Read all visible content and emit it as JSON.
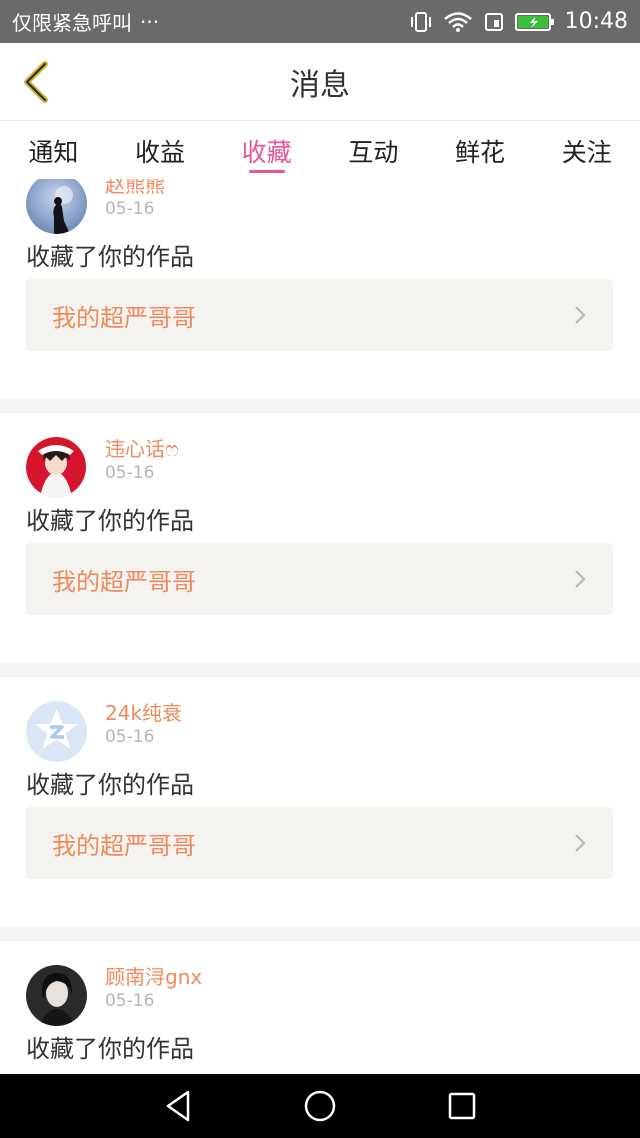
{
  "status_bar": {
    "carrier": "仅限紧急呼叫",
    "more": "···",
    "time": "10:48"
  },
  "header": {
    "title": "消息"
  },
  "tabs": [
    {
      "label": "通知",
      "active": false
    },
    {
      "label": "收益",
      "active": false
    },
    {
      "label": "收藏",
      "active": true
    },
    {
      "label": "互动",
      "active": false
    },
    {
      "label": "鲜花",
      "active": false
    },
    {
      "label": "关注",
      "active": false
    }
  ],
  "colors": {
    "accent": "#e8559a",
    "username": "#f08a5d",
    "link_bg": "#f4f3ef"
  },
  "items": [
    {
      "username": "赵熊熊",
      "date": "05-16",
      "action": "收藏了你的作品",
      "work": "我的超严哥哥"
    },
    {
      "username": "违心话ෆ",
      "date": "05-16",
      "action": "收藏了你的作品",
      "work": "我的超严哥哥"
    },
    {
      "username": "24k纯衰",
      "date": "05-16",
      "action": "收藏了你的作品",
      "work": "我的超严哥哥"
    },
    {
      "username": "顾南浔gnx",
      "date": "05-16",
      "action": "收藏了你的作品",
      "work": ""
    }
  ]
}
